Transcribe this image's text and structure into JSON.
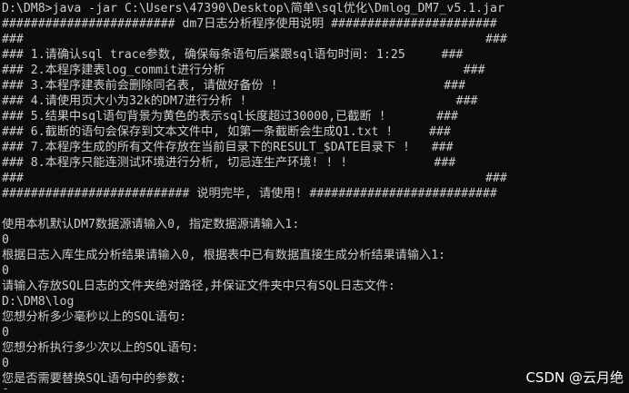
{
  "console": {
    "lines": [
      "D:\\DM8>java -jar C:\\Users\\47390\\Desktop\\简单\\sql优化\\Dmlog_DM7_v5.1.jar",
      "######################## dm7日志分析程序使用说明 #######################",
      "###                                                                ###",
      "### 1.请确认sql trace参数, 确保每条语句后紧跟sql语句时间: 1:25     ###",
      "### 2.本程序建表log_commit进行分析                                 ###",
      "### 3.本程序建表前会删除同名表, 请做好备份 !                       ###",
      "### 4.请使用页大小为32k的DM7进行分析 !                             ###",
      "### 5.结果中sql语句背景为黄色的表示sql长度超过30000,已截断 !       ###",
      "### 6.截断的语句会保存到文本文件中, 如第一条截断会生成Q1.txt !     ###",
      "### 7.本程序生成的所有文件存放在当前目录下的RESULT_$DATE目录下 !   ###",
      "### 8.本程序只能连测试环境进行分析, 切忌连生产环境! ! !            ###",
      "###                                                                ###",
      "########################## 说明完毕, 请使用! ##########################",
      "",
      "使用本机默认DM7数据源请输入0, 指定数据源请输入1:",
      "0",
      "根据日志入库生成分析结果请输入0, 根据表中已有数据直接生成分析结果请输入1:",
      "0",
      "请输入存放SQL日志的文件夹绝对路径,并保证文件夹中只有SQL日志文件:",
      "D:\\DM8\\log",
      "您想分析多少毫秒以上的SQL语句:",
      "0",
      "您想分析执行多少次以上的SQL语句:",
      "0",
      "您是否需要替换SQL语句中的参数:",
      "0"
    ]
  },
  "watermark": {
    "text": "CSDN @云月绝"
  },
  "colors": {
    "background": "#0c0c0c",
    "text": "#cccccc"
  }
}
